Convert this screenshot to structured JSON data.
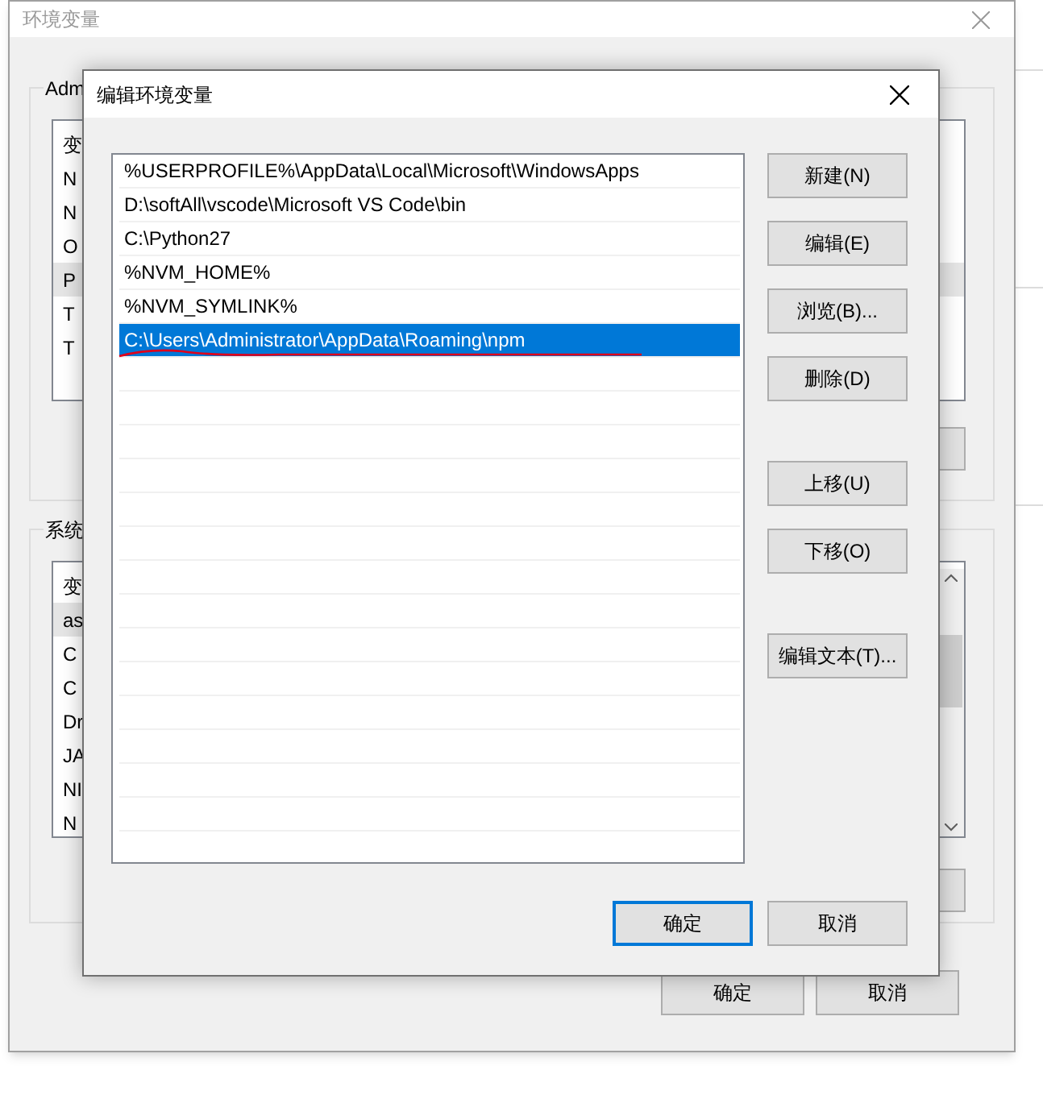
{
  "background_window": {
    "title": "环境变量",
    "user_group": {
      "label": "Adm",
      "rows": [
        "变",
        "N",
        "N",
        "O",
        "P",
        "T",
        "T"
      ]
    },
    "system_group": {
      "label": "系统",
      "rows": [
        "变",
        "as",
        "C",
        "C",
        "Dr",
        "JA",
        "NI",
        "N"
      ]
    },
    "buttons": [
      "确定",
      "取消"
    ]
  },
  "dialog": {
    "title": "编辑环境变量",
    "entries": [
      {
        "text": "%USERPROFILE%\\AppData\\Local\\Microsoft\\WindowsApps",
        "selected": false
      },
      {
        "text": "D:\\softAll\\vscode\\Microsoft VS Code\\bin",
        "selected": false
      },
      {
        "text": "C:\\Python27",
        "selected": false
      },
      {
        "text": "%NVM_HOME%",
        "selected": false
      },
      {
        "text": "%NVM_SYMLINK%",
        "selected": false
      },
      {
        "text": "C:\\Users\\Administrator\\AppData\\Roaming\\npm",
        "selected": true
      }
    ],
    "side_buttons": [
      {
        "label": "新建(N)",
        "kind": "group1"
      },
      {
        "label": "编辑(E)",
        "kind": "group1"
      },
      {
        "label": "浏览(B)...",
        "kind": "group1"
      },
      {
        "label": "删除(D)",
        "kind": "group1"
      },
      {
        "label": "上移(U)",
        "kind": "group2"
      },
      {
        "label": "下移(O)",
        "kind": "group2"
      },
      {
        "label": "编辑文本(T)...",
        "kind": "group3"
      }
    ],
    "buttons": [
      {
        "label": "确定",
        "default": true
      },
      {
        "label": "取消",
        "default": false
      }
    ]
  }
}
